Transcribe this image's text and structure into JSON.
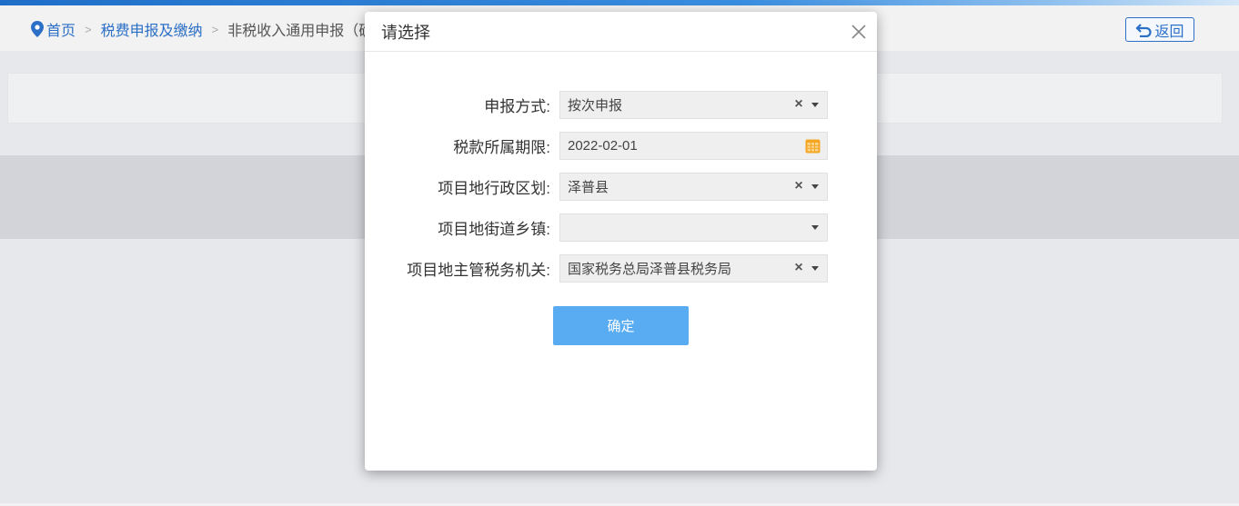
{
  "breadcrumb": {
    "home": "首页",
    "level1": "税费申报及缴纳",
    "level2": "非税收入通用申报（确",
    "separator": ">"
  },
  "back_button": {
    "label": "返回"
  },
  "modal": {
    "title": "请选择",
    "fields": [
      {
        "label": "申报方式:",
        "value": "按次申报"
      },
      {
        "label": "税款所属期限:",
        "value": "2022-02-01"
      },
      {
        "label": "项目地行政区划:",
        "value": "泽普县"
      },
      {
        "label": "项目地街道乡镇:",
        "value": ""
      },
      {
        "label": "项目地主管税务机关:",
        "value": "国家税务总局泽普县税务局"
      }
    ],
    "clear_glyph": "×",
    "confirm_label": "确定"
  },
  "colors": {
    "accent": "#2c6fc6",
    "confirm_button": "#5aacf2",
    "calendar_icon": "#f5a623"
  },
  "icons": [
    "location-pin-icon",
    "return-arrow-icon",
    "close-icon",
    "clear-icon",
    "dropdown-arrow-icon",
    "calendar-icon"
  ]
}
